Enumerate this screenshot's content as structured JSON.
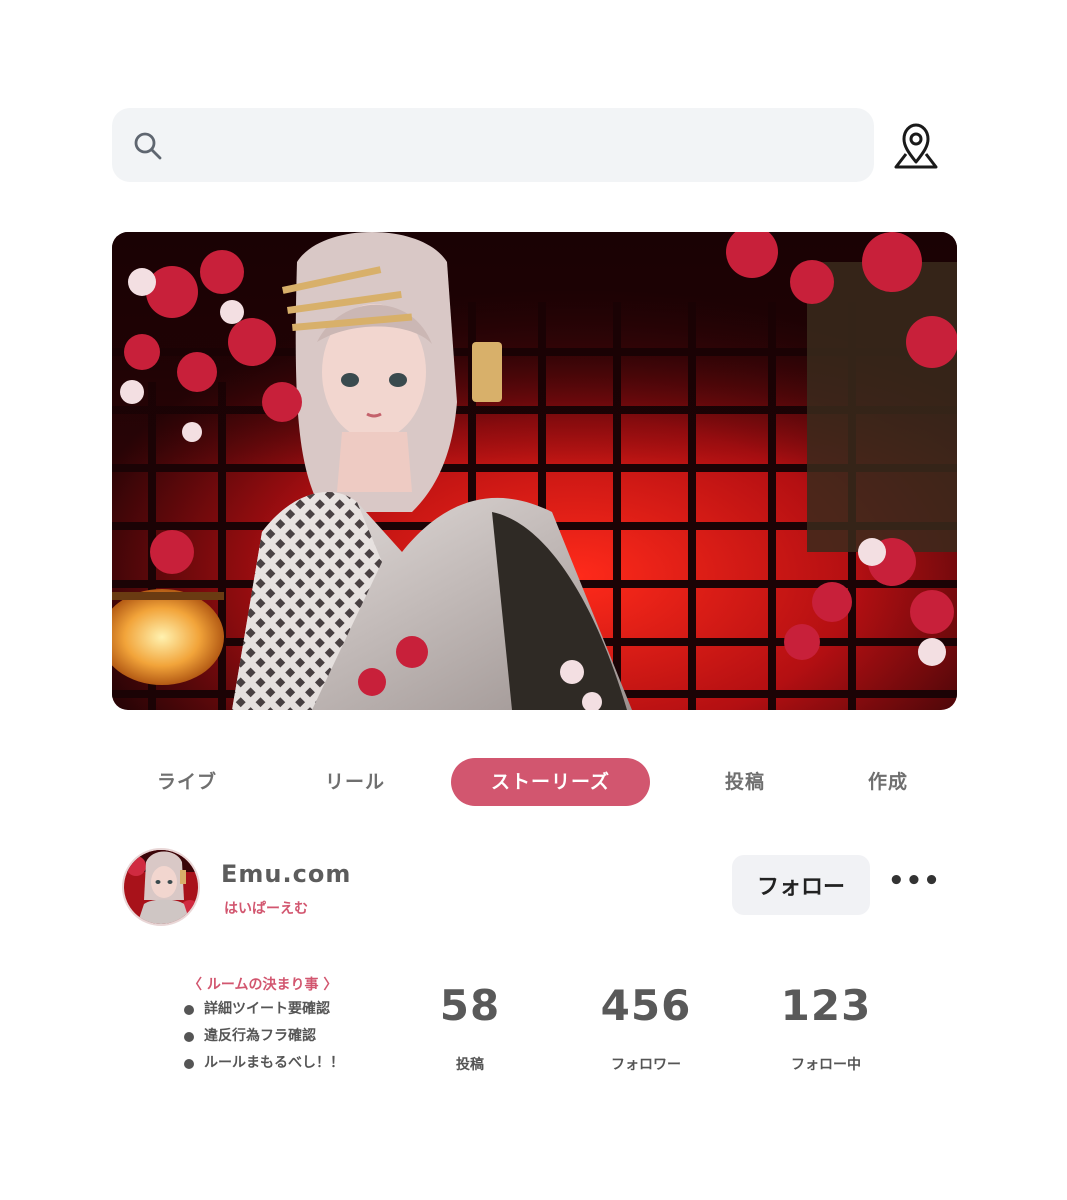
{
  "search": {
    "placeholder": "",
    "icon": "search-icon"
  },
  "header": {
    "location_icon": "map-pin-icon"
  },
  "banner": {
    "description_icon": "banner-image"
  },
  "tabs": [
    {
      "label": "ライブ",
      "active": false
    },
    {
      "label": "リール",
      "active": false
    },
    {
      "label": "ストーリーズ",
      "active": true
    },
    {
      "label": "投稿",
      "active": false
    },
    {
      "label": "作成",
      "active": false
    }
  ],
  "profile": {
    "name": "Emu.com",
    "handle": "はいぱーえむ",
    "follow_label": "フォロー",
    "more_label": "•••"
  },
  "rules": {
    "title": "〈 ルームの決まり事 〉",
    "items": [
      "詳細ツイート要確認",
      "違反行為フラ確認",
      "ルールまもるべし！！"
    ]
  },
  "stats": [
    {
      "value": "58",
      "label": "投稿"
    },
    {
      "value": "456",
      "label": "フォロワー"
    },
    {
      "value": "123",
      "label": "フォロー中"
    }
  ],
  "colors": {
    "accent": "#d2566f",
    "search_bg": "#f2f4f6",
    "follow_bg": "#f1f2f5"
  }
}
